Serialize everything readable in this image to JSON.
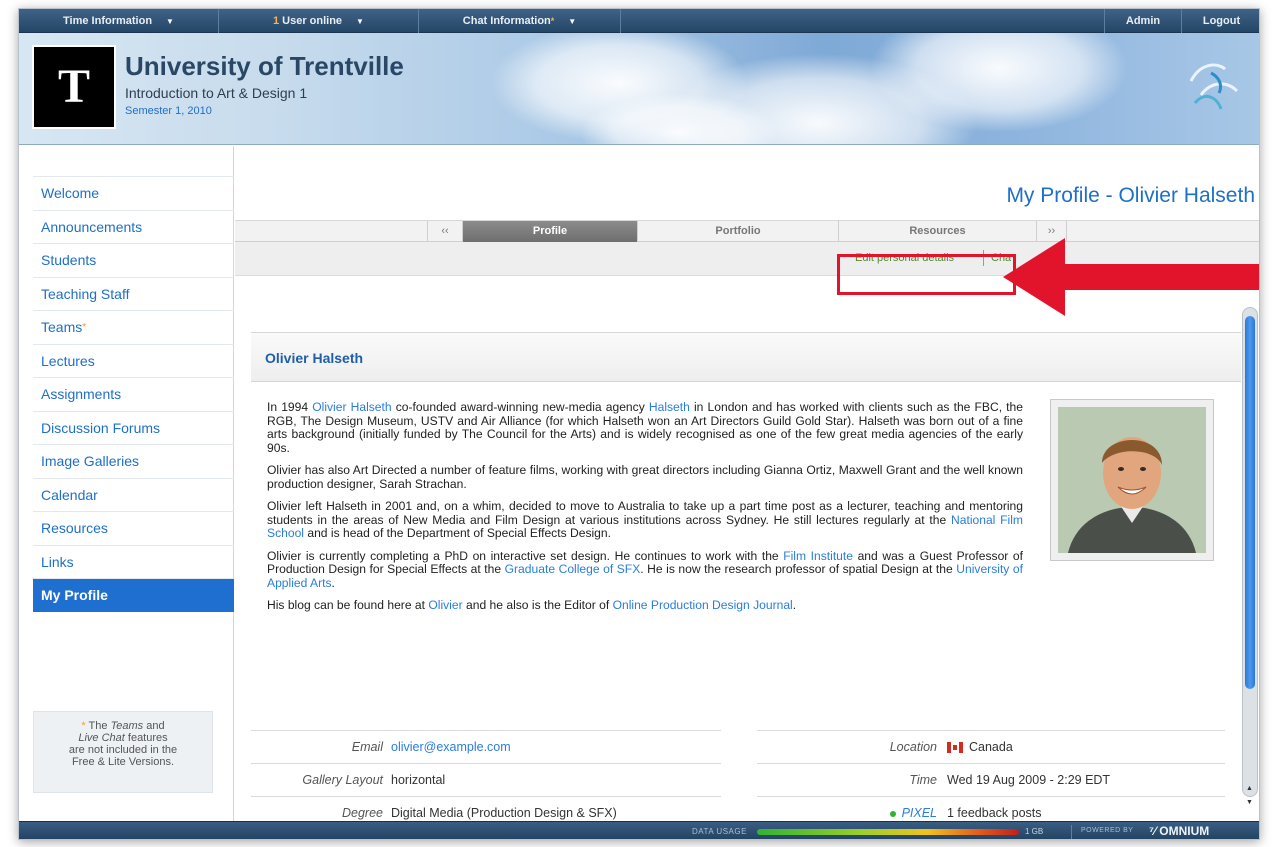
{
  "topbar": {
    "time_info": "Time Information",
    "users_count": "1",
    "users_label": "User online",
    "chat_info": "Chat Information",
    "admin": "Admin",
    "logout": "Logout"
  },
  "header": {
    "logo_letter": "T",
    "university": "University of Trentville",
    "course": "Introduction to Art & Design 1",
    "semester": "Semester 1, 2010"
  },
  "sidebar": {
    "items": [
      {
        "label": "Welcome"
      },
      {
        "label": "Announcements"
      },
      {
        "label": "Students"
      },
      {
        "label": "Teaching Staff"
      },
      {
        "label": "Teams"
      },
      {
        "label": "Lectures"
      },
      {
        "label": "Assignments"
      },
      {
        "label": "Discussion Forums"
      },
      {
        "label": "Image Galleries"
      },
      {
        "label": "Calendar"
      },
      {
        "label": "Resources"
      },
      {
        "label": "Links"
      },
      {
        "label": "My Profile"
      }
    ],
    "note": {
      "star": "*",
      "the": "The",
      "teams": "Teams",
      "and": "and",
      "live_chat": "Live Chat",
      "features": "features",
      "line3": "are not included in the",
      "line4": "Free & Lite Versions."
    }
  },
  "main": {
    "page_title": "My Profile - Olivier Halseth",
    "tabs": {
      "prev": "‹‹",
      "profile": "Profile",
      "portfolio": "Portfolio",
      "resources": "Resources",
      "next": "››"
    },
    "actions": {
      "edit": "Edit personal details",
      "change": "Cha"
    },
    "panel_name": "Olivier Halseth",
    "bio": {
      "p1": {
        "t1": "In 1994 ",
        "l1": "Olivier Halseth",
        "t2": " co-founded award-winning new-media agency ",
        "l2": "Halseth",
        "t3": " in London and has worked with clients such as the FBC, the RGB, The Design Museum, USTV and Air Alliance (for which Halseth won an Art Directors Guild Gold Star). Halseth was born out of a fine arts background (initially funded by The Council for the Arts) and is widely recognised as one of the few great media agencies of the early 90s."
      },
      "p2": "Olivier has also Art Directed a number of feature films, working with great directors including Gianna Ortiz, Maxwell Grant and the well known production designer, Sarah Strachan.",
      "p3": {
        "t1": "Olivier left Halseth in 2001 and, on a whim, decided to move to Australia to take up a part time post as a lecturer, teaching and mentoring students in the areas of New Media and Film Design at various institutions across Sydney. He still lectures regularly at the ",
        "l1": "National Film School",
        "t2": " and is head of the Department of Special Effects Design."
      },
      "p4": {
        "t1": "Olivier is currently completing a PhD on interactive set design. He continues to work with the ",
        "l1": "Film Institute",
        "t2": " and was a Guest Professor of Production Design for Special Effects at the ",
        "l2": "Graduate College of SFX",
        "t3": ". He is now the research professor of spatial Design at the ",
        "l3": "University of Applied Arts",
        "t4": "."
      },
      "p5": {
        "t1": "His blog can be found here at ",
        "l1": "Olivier",
        "t2": " and he also is the Editor of ",
        "l2": "Online Production Design Journal",
        "t3": "."
      }
    },
    "details": {
      "email_label": "Email",
      "email": "olivier@example.com",
      "gallery_label": "Gallery Layout",
      "gallery": "horizontal",
      "degree_label": "Degree",
      "degree": "Digital Media (Production Design & SFX)",
      "location_label": "Location",
      "location": "Canada",
      "time_label": "Time",
      "time": "Wed 19 Aug 2009 - 2:29 EDT",
      "pixel_label": "PIXEL",
      "pixel": "1 feedback posts"
    }
  },
  "footer": {
    "data_usage": "DATA USAGE",
    "usage_value": "1 GB",
    "powered_by": "POWERED BY",
    "brand": "OMNIUM"
  },
  "colors": {
    "accent": "#1e6fc8",
    "active_nav": "#1f6fd0",
    "highlight": "#e2142b",
    "topbar": "#2e5175"
  }
}
